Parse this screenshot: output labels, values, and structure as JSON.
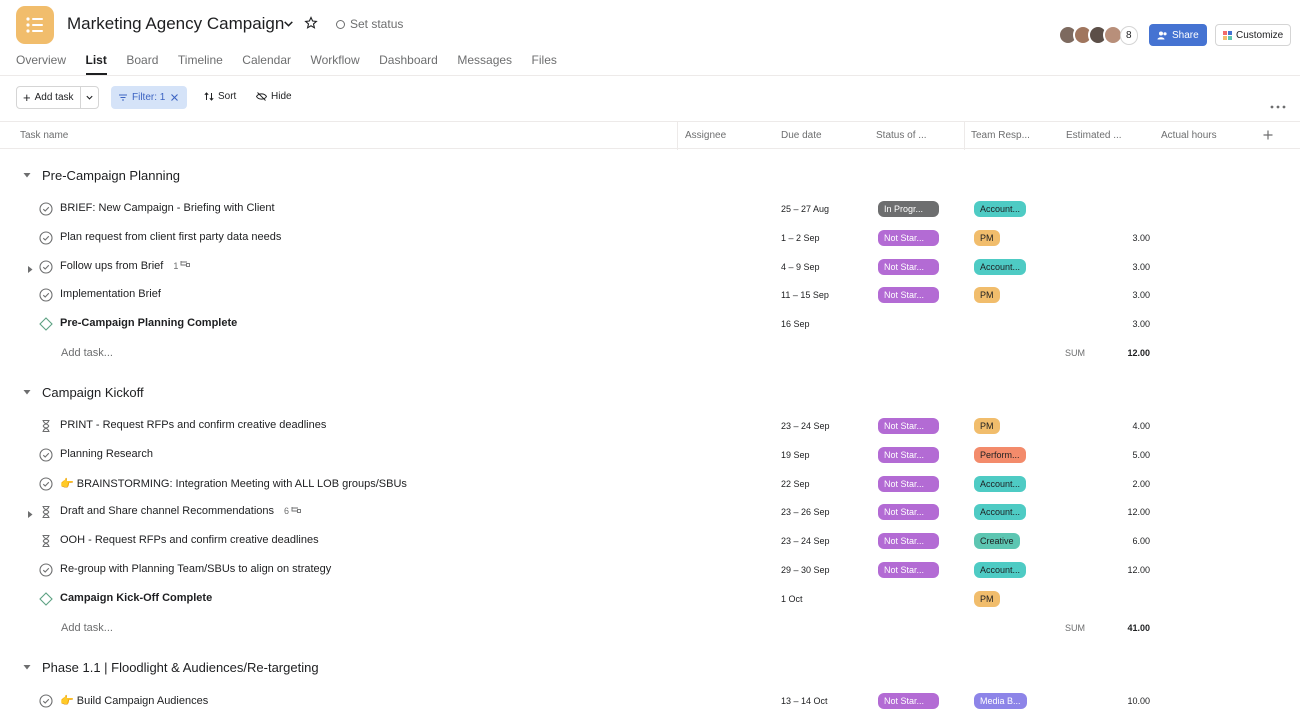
{
  "header": {
    "title": "Marketing Agency Campaign",
    "set_status": "Set status",
    "member_count": "8",
    "share_label": "Share",
    "customize_label": "Customize"
  },
  "tabs": [
    "Overview",
    "List",
    "Board",
    "Timeline",
    "Calendar",
    "Workflow",
    "Dashboard",
    "Messages",
    "Files"
  ],
  "active_tab": "List",
  "toolbar": {
    "add_task": "Add task",
    "filter": "Filter: 1",
    "sort": "Sort",
    "hide": "Hide"
  },
  "columns": {
    "task_name": "Task name",
    "assignee": "Assignee",
    "due_date": "Due date",
    "status": "Status of ...",
    "team": "Team Resp...",
    "estimated": "Estimated ...",
    "actual": "Actual hours"
  },
  "colors": {
    "app_icon": "#f1bd6c",
    "in_progress": "#6d6e6f",
    "not_started": "#b36bd4",
    "account": "#4ecbc4",
    "pm": "#f1bd6c",
    "performance": "#f38b6b",
    "creative": "#5dc6b2",
    "media": "#8d84e8",
    "share": "#4573d2"
  },
  "sections": [
    {
      "name": "Pre-Campaign Planning",
      "tasks": [
        {
          "name": "BRIEF:  New Campaign - Briefing with Client",
          "icon": "check-circle",
          "due": "25 – 27 Aug",
          "status": "In Progr...",
          "team": "Account...",
          "estimated": ""
        },
        {
          "name": "Plan request from client first party data needs",
          "icon": "check-circle",
          "due": "1 – 2 Sep",
          "status": "Not Star...",
          "team": "PM",
          "estimated": "3.00"
        },
        {
          "name": "Follow ups from Brief",
          "icon": "check-circle",
          "due": "4 – 9 Sep",
          "status": "Not Star...",
          "team": "Account...",
          "estimated": "3.00",
          "subtasks": "1",
          "expandable": true
        },
        {
          "name": "Implementation Brief",
          "icon": "check-circle",
          "due": "11 – 15 Sep",
          "status": "Not Star...",
          "team": "PM",
          "estimated": "3.00"
        },
        {
          "name": "Pre-Campaign Planning Complete",
          "icon": "milestone",
          "due": "16 Sep",
          "status": "",
          "team": "",
          "estimated": "3.00"
        }
      ],
      "add_task": "Add task...",
      "sum_label": "SUM",
      "sum": "12.00"
    },
    {
      "name": "Campaign Kickoff",
      "tasks": [
        {
          "name": "PRINT - Request RFPs and confirm creative deadlines",
          "icon": "hourglass",
          "due": "23 – 24 Sep",
          "status": "Not Star...",
          "team": "PM",
          "estimated": "4.00"
        },
        {
          "name": "Planning Research",
          "icon": "check-circle",
          "due": "19 Sep",
          "status": "Not Star...",
          "team": "Perform...",
          "estimated": "5.00"
        },
        {
          "name": "👉 BRAINSTORMING: Integration Meeting with ALL LOB groups/SBUs",
          "icon": "check-circle",
          "due": "22 Sep",
          "status": "Not Star...",
          "team": "Account...",
          "estimated": "2.00"
        },
        {
          "name": "Draft and Share channel Recommendations",
          "icon": "hourglass",
          "due": "23 – 26 Sep",
          "status": "Not Star...",
          "team": "Account...",
          "estimated": "12.00",
          "subtasks": "6",
          "expandable": true
        },
        {
          "name": "OOH - Request RFPs and confirm creative deadlines",
          "icon": "hourglass",
          "due": "23 – 24 Sep",
          "status": "Not Star...",
          "team": "Creative",
          "estimated": "6.00"
        },
        {
          "name": "Re-group with Planning Team/SBUs to align on strategy",
          "icon": "check-circle",
          "due": "29 – 30 Sep",
          "status": "Not Star...",
          "team": "Account...",
          "estimated": "12.00"
        },
        {
          "name": "Campaign Kick-Off Complete",
          "icon": "milestone",
          "due": "1 Oct",
          "status": "",
          "team": "PM",
          "estimated": ""
        }
      ],
      "add_task": "Add task...",
      "sum_label": "SUM",
      "sum": "41.00"
    },
    {
      "name": "Phase 1.1 | Floodlight & Audiences/Re-targeting",
      "tasks": [
        {
          "name": "👉 Build Campaign Audiences",
          "icon": "check-circle",
          "due": "13 – 14 Oct",
          "status": "Not Star...",
          "team": "Media B...",
          "estimated": "10.00"
        }
      ]
    }
  ]
}
